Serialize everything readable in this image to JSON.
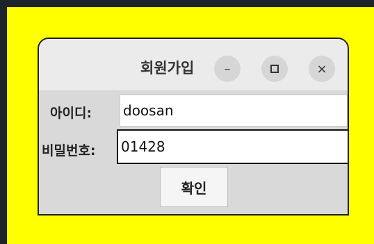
{
  "window": {
    "title": "회원가입",
    "controls": {
      "minimize_icon": "–",
      "maximize_icon": "square",
      "close_icon": "×"
    }
  },
  "form": {
    "id_label": "아이디:",
    "id_value": "doosan",
    "password_label": "비밀번호:",
    "password_value": "01428",
    "confirm_label": "확인"
  },
  "colors": {
    "background": "#1f232a",
    "outer_panel": "#ffff00",
    "window_bg": "#d9d9d9",
    "titlebar_bg": "#ebebeb"
  }
}
